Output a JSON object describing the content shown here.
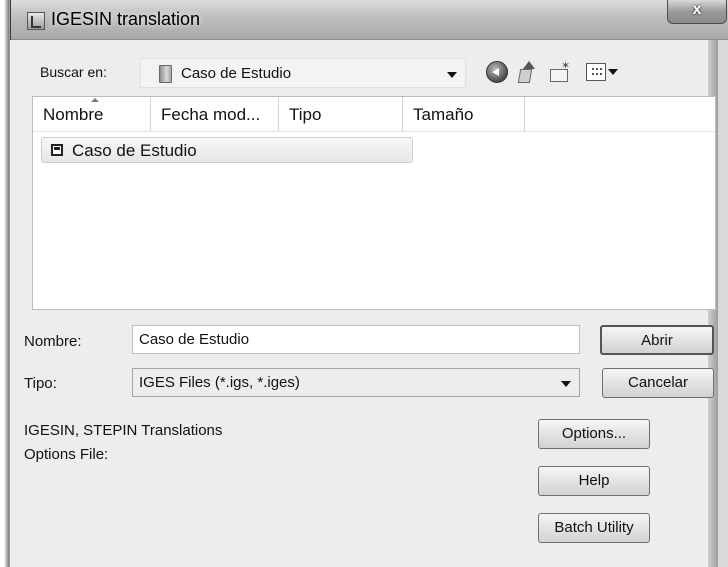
{
  "window": {
    "title": "IGESIN translation",
    "close_label": "x"
  },
  "look_in": {
    "label": "Buscar en:",
    "value": "Caso de Estudio"
  },
  "toolbar": {
    "back_icon": "back-icon",
    "up_icon": "up-folder-icon",
    "new_folder_icon": "new-folder-icon",
    "view_menu_icon": "view-menu-icon"
  },
  "file_list": {
    "columns": [
      "Nombre",
      "Fecha mod...",
      "Tipo",
      "Tamaño"
    ],
    "items": [
      {
        "name": "Caso de Estudio",
        "icon": "archive-icon"
      }
    ]
  },
  "file_name": {
    "label": "Nombre:",
    "value": "Caso de Estudio"
  },
  "file_type": {
    "label": "Tipo:",
    "value": "IGES Files (*.igs, *.iges)"
  },
  "buttons": {
    "open": "Abrir",
    "cancel": "Cancelar",
    "options": "Options...",
    "help": "Help",
    "batch": "Batch Utility"
  },
  "info": {
    "translations": "IGESIN, STEPIN Translations",
    "options_file": "Options File:"
  }
}
